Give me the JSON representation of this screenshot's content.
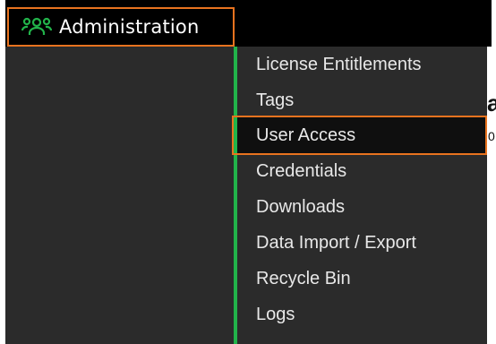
{
  "menu": {
    "title": "Administration",
    "icon": "users-group-icon",
    "accent_color": "#22b34a",
    "highlight_color": "#e8731f",
    "active_item": "User Access",
    "items": [
      {
        "label": "License Entitlements"
      },
      {
        "label": "Tags"
      },
      {
        "label": "User Access"
      },
      {
        "label": "Credentials"
      },
      {
        "label": "Downloads"
      },
      {
        "label": "Data Import / Export"
      },
      {
        "label": "Recycle Bin"
      },
      {
        "label": "Logs"
      }
    ]
  },
  "background": {
    "fragment_large": "a",
    "fragment_small": "0"
  }
}
